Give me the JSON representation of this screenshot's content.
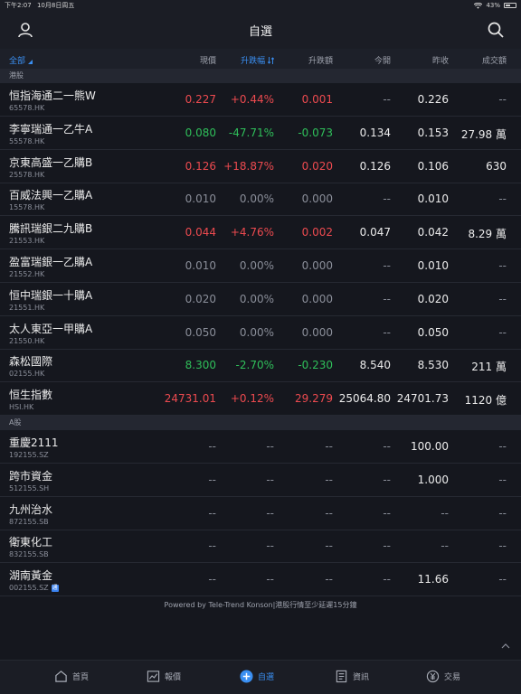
{
  "status_bar": {
    "time": "下午2:07",
    "date": "10月8日周五",
    "battery": "43%"
  },
  "header": {
    "title": "自選"
  },
  "columns": {
    "name": "全部",
    "price": "現價",
    "pct": "升跌幅",
    "chg": "升跌額",
    "open": "今開",
    "prev": "昨收",
    "vol": "成交額"
  },
  "sections": {
    "hk": "港股",
    "a": "A股"
  },
  "hk_rows": [
    {
      "name": "恒指海通二一熊W",
      "code": "65578.HK",
      "price": "0.227",
      "pct": "+0.44%",
      "chg": "0.001",
      "open": "--",
      "prev": "0.226",
      "vol": "--",
      "trend": "up"
    },
    {
      "name": "李寧瑞通一乙牛A",
      "code": "55578.HK",
      "price": "0.080",
      "pct": "-47.71%",
      "chg": "-0.073",
      "open": "0.134",
      "prev": "0.153",
      "vol": "27.98 萬",
      "trend": "down"
    },
    {
      "name": "京東高盛一乙購B",
      "code": "25578.HK",
      "price": "0.126",
      "pct": "+18.87%",
      "chg": "0.020",
      "open": "0.126",
      "prev": "0.106",
      "vol": "630",
      "trend": "up"
    },
    {
      "name": "百威法興一乙購A",
      "code": "15578.HK",
      "price": "0.010",
      "pct": "0.00%",
      "chg": "0.000",
      "open": "--",
      "prev": "0.010",
      "vol": "--",
      "trend": "flat"
    },
    {
      "name": "騰訊瑞銀二九購B",
      "code": "21553.HK",
      "price": "0.044",
      "pct": "+4.76%",
      "chg": "0.002",
      "open": "0.047",
      "prev": "0.042",
      "vol": "8.29 萬",
      "trend": "up"
    },
    {
      "name": "盈富瑞銀一乙購A",
      "code": "21552.HK",
      "price": "0.010",
      "pct": "0.00%",
      "chg": "0.000",
      "open": "--",
      "prev": "0.010",
      "vol": "--",
      "trend": "flat"
    },
    {
      "name": "恒中瑞銀一十購A",
      "code": "21551.HK",
      "price": "0.020",
      "pct": "0.00%",
      "chg": "0.000",
      "open": "--",
      "prev": "0.020",
      "vol": "--",
      "trend": "flat"
    },
    {
      "name": "太人東亞一甲購A",
      "code": "21550.HK",
      "price": "0.050",
      "pct": "0.00%",
      "chg": "0.000",
      "open": "--",
      "prev": "0.050",
      "vol": "--",
      "trend": "flat"
    },
    {
      "name": "森松國際",
      "code": "02155.HK",
      "price": "8.300",
      "pct": "-2.70%",
      "chg": "-0.230",
      "open": "8.540",
      "prev": "8.530",
      "vol": "211 萬",
      "trend": "down"
    },
    {
      "name": "恒生指數",
      "code": "HSI.HK",
      "price": "24731.01",
      "pct": "+0.12%",
      "chg": "29.279",
      "open": "25064.80",
      "prev": "24701.73",
      "vol": "1120 億",
      "trend": "up"
    }
  ],
  "a_rows": [
    {
      "name": "重慶2111",
      "code": "192155.SZ",
      "price": "--",
      "pct": "--",
      "chg": "--",
      "open": "--",
      "prev": "100.00",
      "vol": "--",
      "trend": "flat"
    },
    {
      "name": "跨市資金",
      "code": "512155.SH",
      "price": "--",
      "pct": "--",
      "chg": "--",
      "open": "--",
      "prev": "1.000",
      "vol": "--",
      "trend": "flat"
    },
    {
      "name": "九州治水",
      "code": "872155.SB",
      "price": "--",
      "pct": "--",
      "chg": "--",
      "open": "--",
      "prev": "--",
      "vol": "--",
      "trend": "flat"
    },
    {
      "name": "衛東化工",
      "code": "832155.SB",
      "price": "--",
      "pct": "--",
      "chg": "--",
      "open": "--",
      "prev": "--",
      "vol": "--",
      "trend": "flat"
    },
    {
      "name": "湖南黃金",
      "code": "002155.SZ",
      "price": "--",
      "pct": "--",
      "chg": "--",
      "open": "--",
      "prev": "11.66",
      "vol": "--",
      "trend": "flat",
      "badge": "通"
    }
  ],
  "footer": {
    "powered": "Powered by Tele-Trend Konson|港股行情至少延遲15分鐘"
  },
  "tabs": [
    {
      "label": "首頁",
      "icon": "home-icon",
      "active": false
    },
    {
      "label": "報價",
      "icon": "chart-icon",
      "active": false
    },
    {
      "label": "自選",
      "icon": "plus-circle-icon",
      "active": true
    },
    {
      "label": "資訊",
      "icon": "document-icon",
      "active": false
    },
    {
      "label": "交易",
      "icon": "currency-icon",
      "active": false
    }
  ],
  "colors": {
    "up": "#ec4a4f",
    "down": "#2fbf5a",
    "accent": "#3a8ff2",
    "background": "#15171e"
  }
}
